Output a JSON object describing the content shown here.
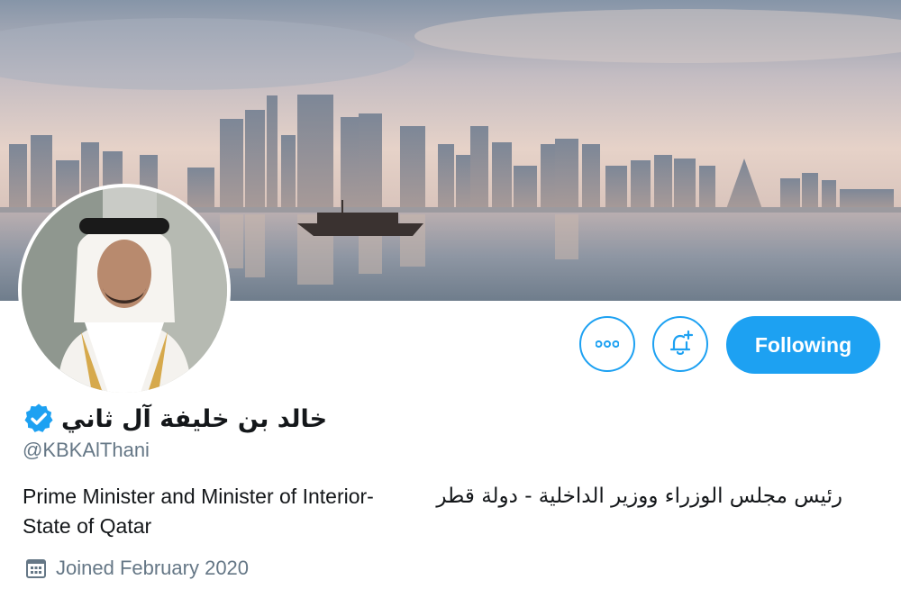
{
  "profile": {
    "display_name": "خالد بن خليفة آل ثاني",
    "handle": "@KBKAlThani",
    "bio_en_line1": "Prime Minister and Minister of Interior-",
    "bio_en_line2": "State of Qatar",
    "bio_ar": "رئيس مجلس الوزراء ووزير الداخلية - دولة قطر",
    "joined": "Joined February 2020",
    "verified": true
  },
  "actions": {
    "more_icon": "more-horizontal-icon",
    "notify_icon": "bell-plus-icon",
    "follow_label": "Following"
  },
  "colors": {
    "accent": "#1da1f2",
    "text": "#14171a",
    "secondary_text": "#657786"
  }
}
